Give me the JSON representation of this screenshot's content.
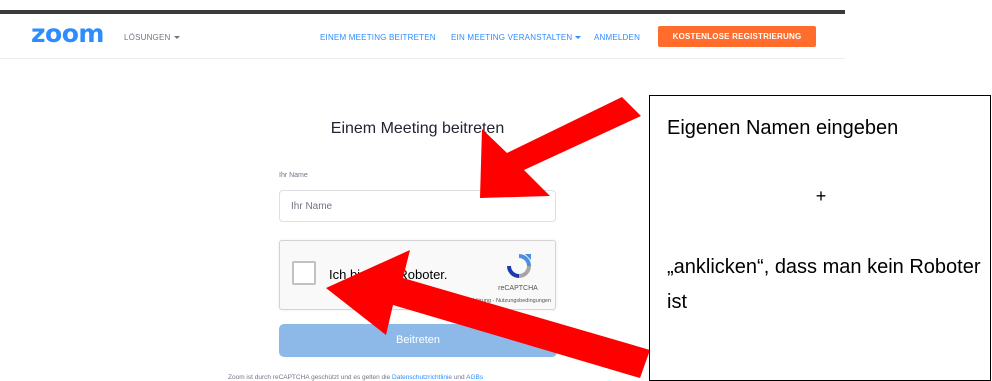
{
  "header": {
    "logo": "zoom",
    "solutions": "LÖSUNGEN",
    "join_meeting": "EINEM MEETING BEITRETEN",
    "host_meeting": "EIN MEETING VERANSTALTEN",
    "sign_in": "ANMELDEN",
    "sign_up": "KOSTENLOSE REGISTRIERUNG"
  },
  "form": {
    "title": "Einem Meeting beitreten",
    "name_label": "Ihr Name",
    "name_placeholder": "Ihr Name",
    "name_value": "",
    "join_button": "Beitreten"
  },
  "recaptcha": {
    "checkbox_label": "Ich bin kein Roboter.",
    "brand": "reCAPTCHA",
    "terms": "Datenschutzerklärung - Nutzungsbedingungen"
  },
  "footer": {
    "text": "Zoom ist durch reCAPTCHA geschützt und es gelten die ",
    "link_privacy": "Datenschutzrichtlinie",
    "connector": " und ",
    "link_terms": "AGBs"
  },
  "annotation": {
    "line1": "Eigenen Namen eingeben",
    "plus": "+",
    "line2": "„anklicken“, dass man kein Roboter ist"
  },
  "colors": {
    "zoom_blue": "#2d8cff",
    "signup_orange": "#ff6c2c",
    "join_button_disabled": "#8db9e8",
    "arrow_red": "#ff0000"
  },
  "icons": [
    "recaptcha-logo-icon",
    "caret-down-icon"
  ]
}
